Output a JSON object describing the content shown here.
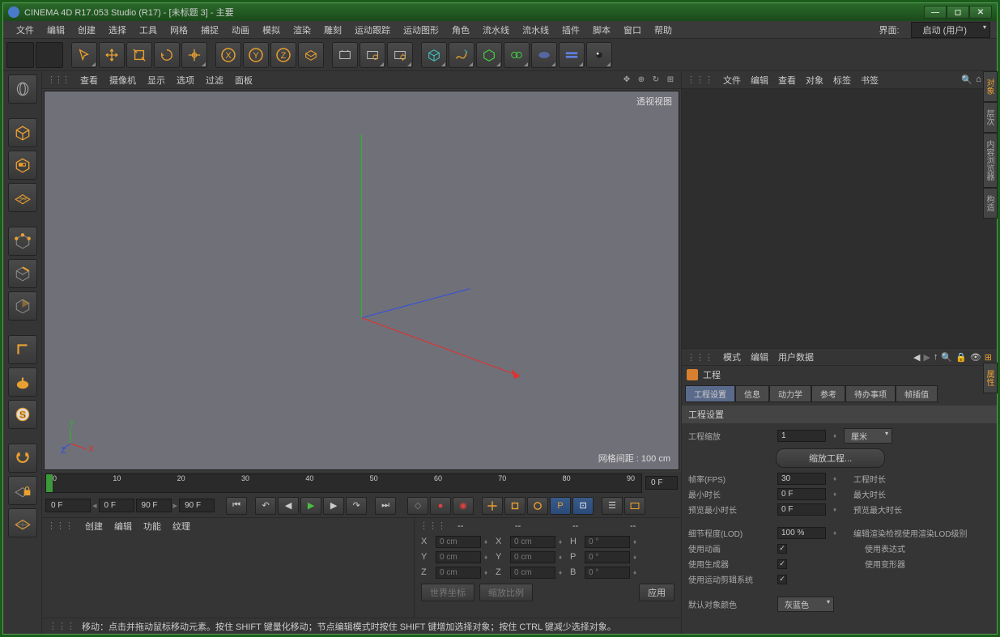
{
  "title": "CINEMA 4D R17.053 Studio (R17) - [未标题 3] - 主要",
  "menu": [
    "文件",
    "编辑",
    "创建",
    "选择",
    "工具",
    "网格",
    "捕捉",
    "动画",
    "模拟",
    "渲染",
    "雕刻",
    "运动跟踪",
    "运动图形",
    "角色",
    "流水线",
    "流水线",
    "插件",
    "脚本",
    "窗口",
    "帮助"
  ],
  "interface": {
    "label": "界面:",
    "value": "启动 (用户)"
  },
  "view_menu": [
    "查看",
    "摄像机",
    "显示",
    "选项",
    "过滤",
    "面板"
  ],
  "viewport": {
    "label": "透视视图",
    "grid": "网格间距 : 100 cm"
  },
  "ruler_ticks": [
    "0",
    "10",
    "20",
    "30",
    "40",
    "50",
    "60",
    "70",
    "80",
    "90"
  ],
  "ruler_end": "0 F",
  "transport": {
    "cur": "0 F",
    "start": "0 F",
    "end": "90 F",
    "goto": "90 F"
  },
  "bottom_left_menu": [
    "创建",
    "编辑",
    "功能",
    "纹理"
  ],
  "coord_hdr": [
    "--",
    "--",
    "--",
    "--"
  ],
  "coords": {
    "rows": [
      {
        "a": "X",
        "v1": "0 cm",
        "b": "X",
        "v2": "0 cm",
        "c": "H",
        "v3": "0 °"
      },
      {
        "a": "Y",
        "v1": "0 cm",
        "b": "Y",
        "v2": "0 cm",
        "c": "P",
        "v3": "0 °"
      },
      {
        "a": "Z",
        "v1": "0 cm",
        "b": "Z",
        "v2": "0 cm",
        "c": "B",
        "v3": "0 °"
      }
    ],
    "btn1": "世界坐标",
    "btn2": "缩放比例",
    "apply": "应用"
  },
  "status": "移动：点击并拖动鼠标移动元素。按住 SHIFT 键量化移动；节点编辑模式时按住 SHIFT 键增加选择对象；按住 CTRL 键减少选择对象。",
  "obj_menu": [
    "文件",
    "编辑",
    "查看",
    "对象",
    "标签",
    "书签"
  ],
  "attr_menu": [
    "模式",
    "编辑",
    "用户数据"
  ],
  "attr_title": "工程",
  "tabs": [
    "工程设置",
    "信息",
    "动力学",
    "参考",
    "待办事项",
    "帧插值"
  ],
  "panel_hdr": "工程设置",
  "props": {
    "scale_lbl": "工程缩放",
    "scale_val": "1",
    "scale_unit": "厘米",
    "scale_btn": "缩放工程...",
    "fps_lbl": "帧率(FPS)",
    "fps_val": "30",
    "duration_lbl": "工程时长",
    "min_lbl": "最小时长",
    "min_val": "0 F",
    "max_lbl": "最大时长",
    "pmin_lbl": "预览最小时长",
    "pmin_val": "0 F",
    "pmax_lbl": "预览最大时长",
    "lod_lbl": "细节程度(LOD)",
    "lod_val": "100 %",
    "lod_txt": "编辑渲染检视使用渲染LOD级别",
    "anim_lbl": "使用动画",
    "expr_lbl": "使用表达式",
    "gen_lbl": "使用生成器",
    "def_lbl": "使用变形器",
    "mot_lbl": "使用运动剪辑系统",
    "color_lbl": "默认对象颜色",
    "color_val": "灰蓝色"
  },
  "side_tabs": [
    "对象",
    "层次",
    "内容浏览器",
    "构造"
  ],
  "side_tabs2": [
    "属性"
  ]
}
